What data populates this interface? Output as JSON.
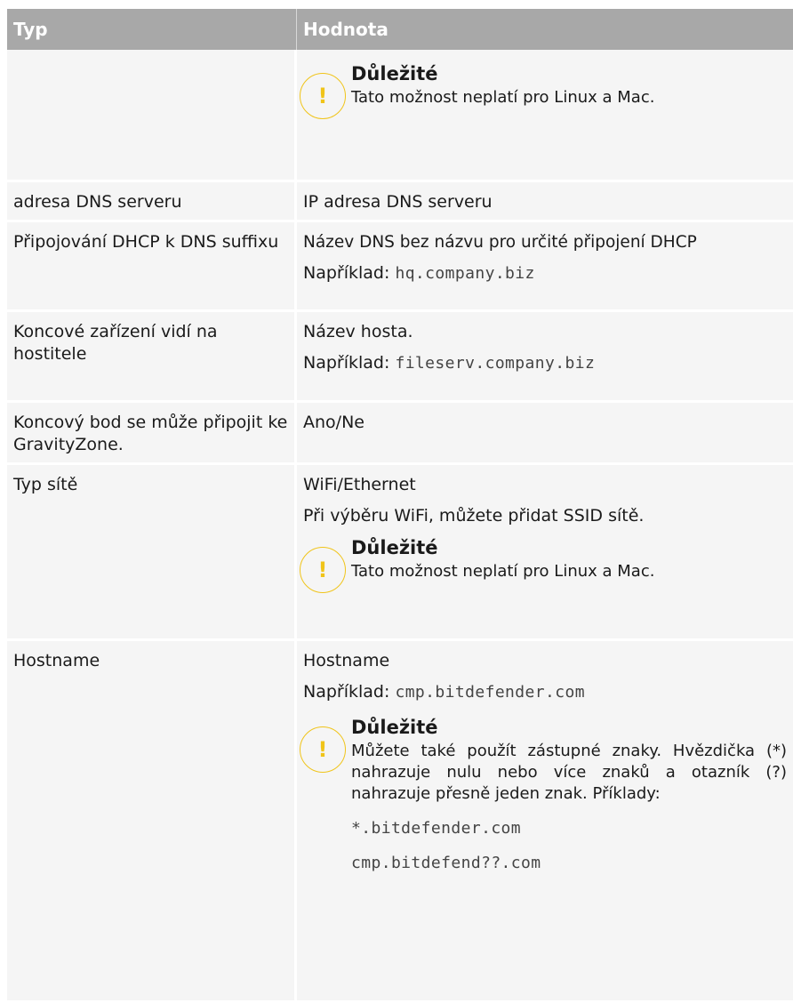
{
  "header": {
    "col_type": "Typ",
    "col_value": "Hodnota"
  },
  "important_title": "Důležité",
  "rows": [
    {
      "type": "",
      "note": "Tato možnost neplatí pro Linux a Mac."
    },
    {
      "type": "adresa DNS serveru",
      "value": "IP adresa DNS serveru"
    },
    {
      "type": "Připojování DHCP k DNS suffixu",
      "value": "Název DNS bez názvu pro určité připojení DHCP",
      "example_label": "Například:",
      "example": "hq.company.biz"
    },
    {
      "type": "Koncové zařízení vidí na hostitele",
      "value": "Název hosta.",
      "example_label": "Například:",
      "example": "fileserv.company.biz"
    },
    {
      "type": "Koncový bod se může připojit ke GravityZone.",
      "value": "Ano/Ne"
    },
    {
      "type": "Typ sítě",
      "value": "WiFi/Ethernet",
      "value2": "Při výběru WiFi, můžete přidat SSID sítě.",
      "note": "Tato možnost neplatí pro Linux a Mac."
    },
    {
      "type": "Hostname",
      "value": "Hostname",
      "example_label": "Například:",
      "example": "cmp.bitdefender.com",
      "note": "Můžete také použít zástupné znaky. Hvězdička (*) nahrazuje nulu nebo více znaků a otazník (?) nahrazuje přesně jeden znak. Příklady:",
      "examples": [
        "*.bitdefender.com",
        "cmp.bitdefend??.com"
      ]
    }
  ]
}
